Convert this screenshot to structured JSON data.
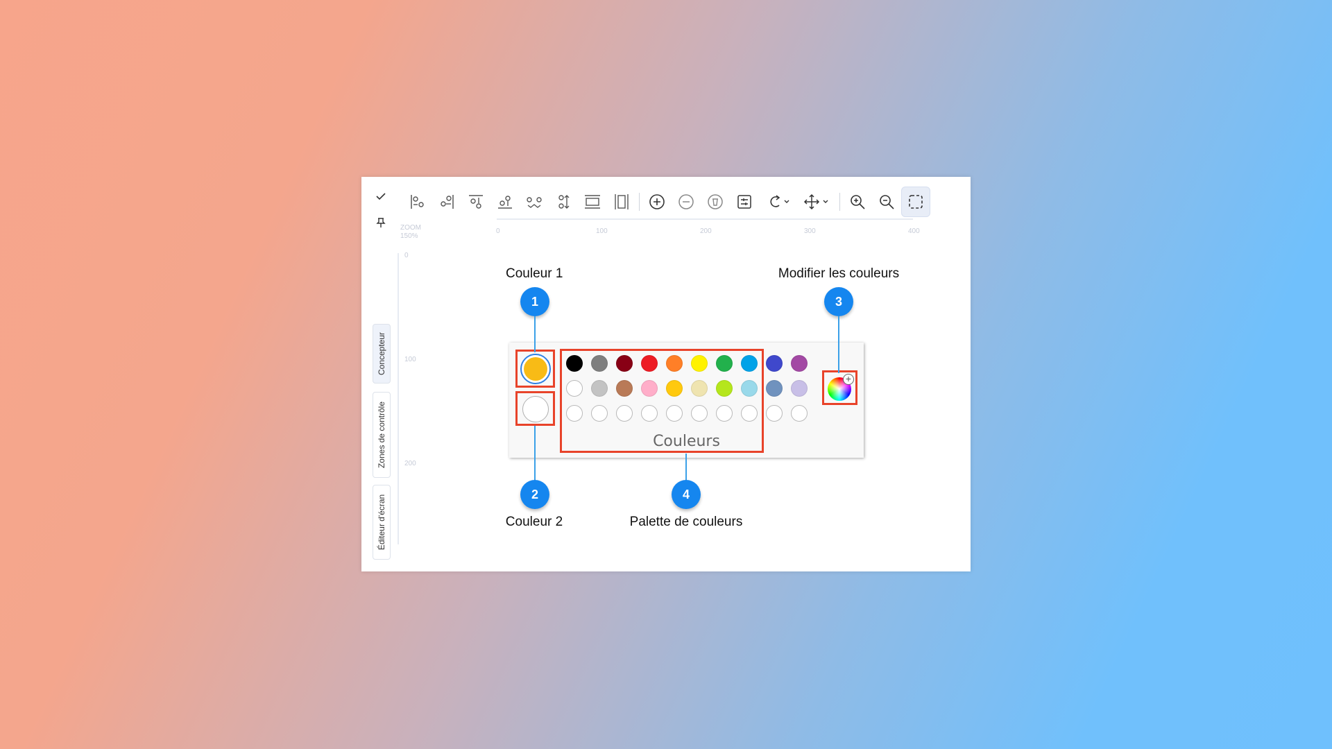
{
  "sidebar_tabs": [
    "Concepteur",
    "Zones de contrôle",
    "Éditeur d'écran"
  ],
  "zoom": {
    "label": "ZOOM",
    "value": "150%"
  },
  "ruler": {
    "h": [
      "0",
      "100",
      "200",
      "300",
      "400"
    ],
    "v": [
      "0",
      "100",
      "200"
    ]
  },
  "toolbar_icons": [
    "align-left-icon",
    "align-right-icon",
    "align-top-icon",
    "align-bottom-icon",
    "distribute-horizontal-icon",
    "distribute-vertical-icon",
    "same-width-icon",
    "same-height-icon",
    "add-circle-icon",
    "remove-circle-icon",
    "delete-icon",
    "properties-icon",
    "rotate-icon",
    "move-icon",
    "zoom-in-icon",
    "zoom-out-icon",
    "select-area-icon"
  ],
  "panel": {
    "title": "Couleurs",
    "color1": "#f8bb16",
    "color2": "#ffffff",
    "palette_rows": [
      [
        "#000000",
        "#7f7f7f",
        "#880015",
        "#ed1c24",
        "#ff7f27",
        "#fff200",
        "#22b14c",
        "#00a2e8",
        "#3f48cc",
        "#a349a4"
      ],
      [
        "#ffffff",
        "#c3c3c3",
        "#b97a57",
        "#ffaec9",
        "#ffc90e",
        "#efe4b0",
        "#b5e61d",
        "#99d9ea",
        "#7092be",
        "#c8bfe7"
      ],
      [
        "",
        "",
        "",
        "",
        "",
        "",
        "",
        "",
        "",
        ""
      ]
    ]
  },
  "callouts": [
    {
      "num": "1",
      "label": "Couleur 1"
    },
    {
      "num": "2",
      "label": "Couleur 2"
    },
    {
      "num": "3",
      "label": "Modifier les couleurs"
    },
    {
      "num": "4",
      "label": "Palette de couleurs"
    }
  ],
  "colors": {
    "badge": "#1586ef",
    "highlight": "#e8432a",
    "leader": "#3aa0e8"
  }
}
